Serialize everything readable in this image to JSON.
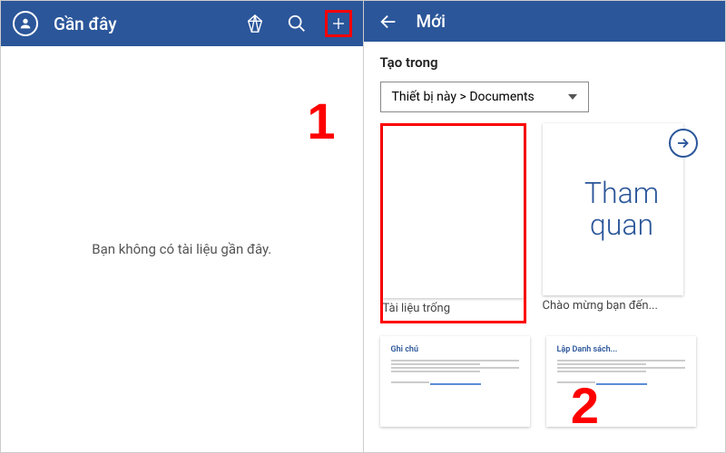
{
  "left": {
    "title": "Gần đây",
    "empty_message": "Bạn không có tài liệu gần đây.",
    "annotation": "1"
  },
  "right": {
    "title": "Mới",
    "create_in_label": "Tạo trong",
    "dropdown_value": "Thiết bị này > Documents",
    "templates": [
      {
        "caption": "Tài liệu trống"
      },
      {
        "caption": "Chào mừng bạn đến...",
        "tour_text": "Tham quan"
      }
    ],
    "mini": [
      {
        "title": "Ghi chú"
      },
      {
        "title": "Lập Danh sách..."
      }
    ],
    "annotation": "2"
  },
  "icons": {
    "account": "account-icon",
    "premium": "premium-icon",
    "search": "search-icon",
    "add": "add-icon",
    "back": "back-icon",
    "dropdown": "dropdown-icon",
    "arrow_right": "arrow-right-icon"
  }
}
